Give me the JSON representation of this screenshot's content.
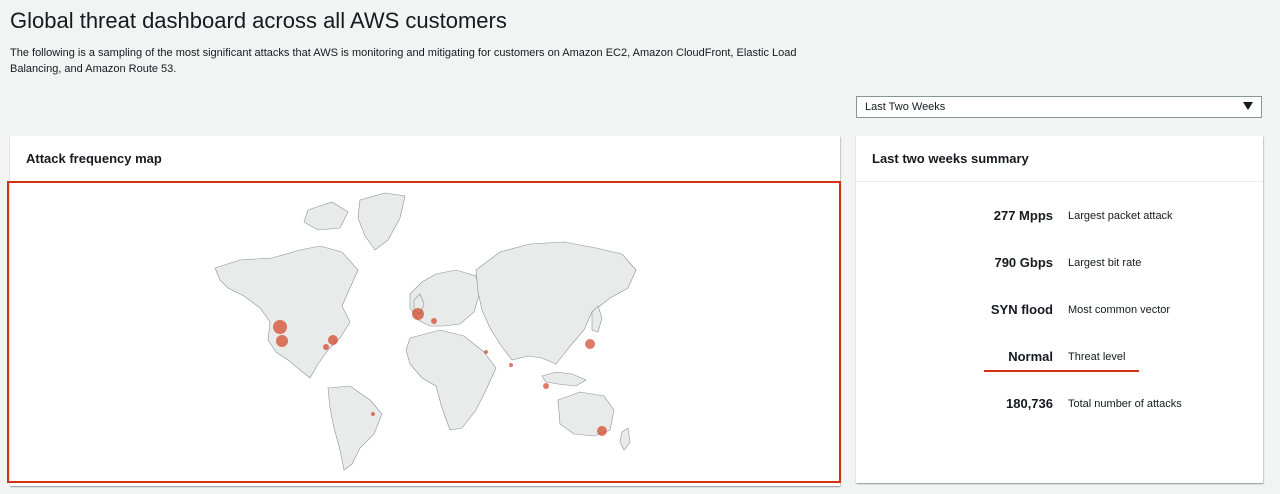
{
  "page": {
    "title": "Global threat dashboard across all AWS customers",
    "description": "The following is a sampling of the most significant attacks that AWS is monitoring and mitigating for customers on Amazon EC2, Amazon CloudFront, Elastic Load Balancing, and Amazon Route 53."
  },
  "range_select": {
    "selected": "Last Two Weeks"
  },
  "map_card": {
    "title": "Attack frequency map"
  },
  "summary_card": {
    "title": "Last two weeks summary",
    "rows": [
      {
        "value": "277 Mpps",
        "label": "Largest packet attack"
      },
      {
        "value": "790 Gbps",
        "label": "Largest bit rate"
      },
      {
        "value": "SYN flood",
        "label": "Most common vector"
      },
      {
        "value": "Normal",
        "label": "Threat level"
      },
      {
        "value": "180,736",
        "label": "Total number of attacks"
      }
    ]
  },
  "colors": {
    "accent": "#d13212",
    "land": "#e9ebeb",
    "border": "#879596"
  }
}
